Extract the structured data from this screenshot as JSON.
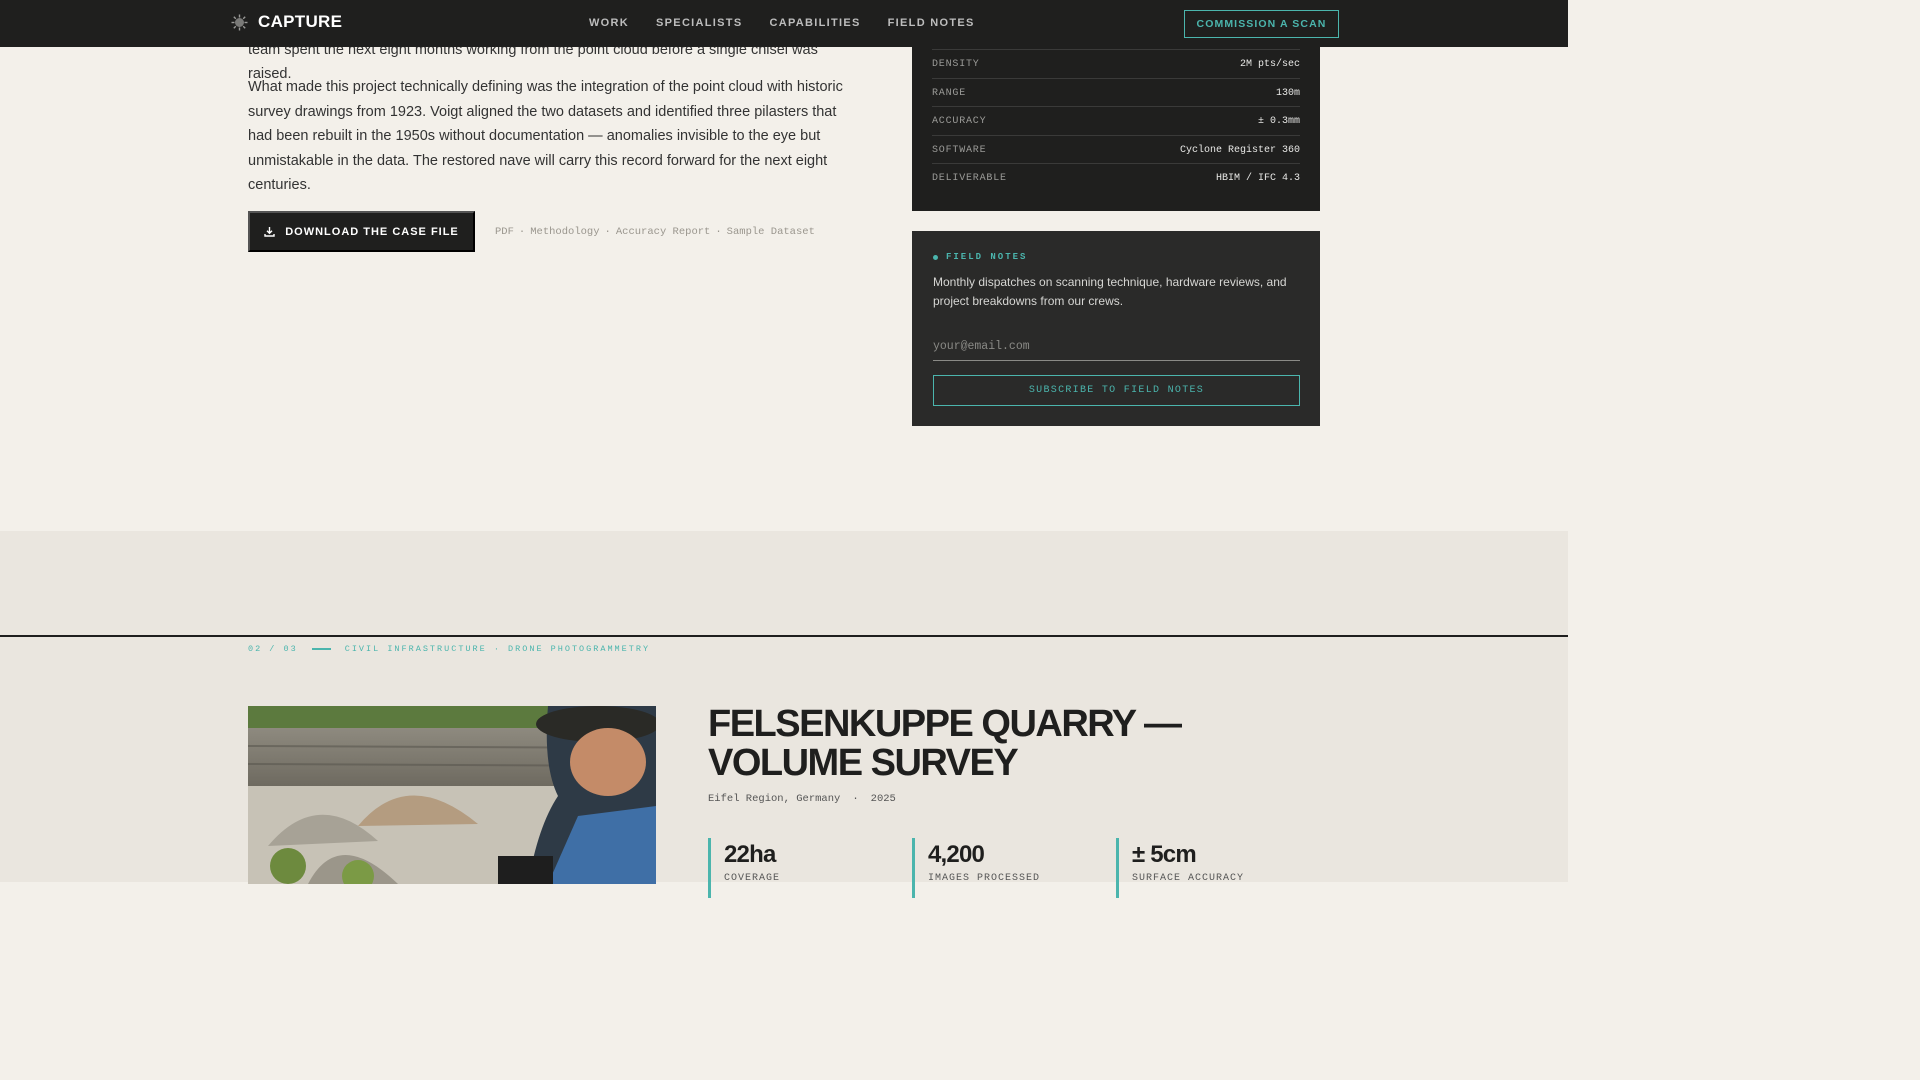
{
  "nav": {
    "brand": "CAPTURE",
    "links": [
      "WORK",
      "SPECIALISTS",
      "CAPABILITIES",
      "FIELD NOTES"
    ],
    "cta": "COMMISSION A SCAN"
  },
  "article": {
    "cut_line": "team spent the next eight months working from the point cloud before a single chisel was raised.",
    "paragraph": "What made this project technically defining was the integration of the point cloud with historic survey drawings from 1923. Voigt aligned the two datasets and identified three pilasters that had been rebuilt in the 1950s without documentation — anomalies invisible to the eye but unmistakable in the data. The restored nave will carry this record forward for the next eight centuries.",
    "download_label": "DOWNLOAD THE CASE FILE",
    "file_meta": [
      "PDF",
      "Methodology",
      "Accuracy Report",
      "Sample Dataset"
    ]
  },
  "specs": {
    "rows": [
      {
        "label": "DENSITY",
        "value": "2M pts/sec"
      },
      {
        "label": "RANGE",
        "value": "130m"
      },
      {
        "label": "ACCURACY",
        "value": "± 0.3mm"
      },
      {
        "label": "SOFTWARE",
        "value": "Cyclone Register 360"
      },
      {
        "label": "DELIVERABLE",
        "value": "HBIM / IFC 4.3"
      }
    ]
  },
  "field_notes": {
    "eyebrow": "FIELD NOTES",
    "description": "Monthly dispatches on scanning technique, hardware reviews, and project breakdowns from our crews.",
    "email_placeholder": "your@email.com",
    "subscribe_label": "SUBSCRIBE TO FIELD NOTES"
  },
  "case2": {
    "index": "02 / 03",
    "category": "CIVIL INFRASTRUCTURE · DRONE PHOTOGRAMMETRY",
    "title": "FELSENKUPPE QUARRY — VOLUME SURVEY",
    "location": "Eifel Region, Germany",
    "year": "2025",
    "stats": [
      {
        "value": "22ha",
        "label": "COVERAGE"
      },
      {
        "value": "4,200",
        "label": "IMAGES PROCESSED"
      },
      {
        "value": "± 5cm",
        "label": "SURFACE ACCURACY"
      }
    ]
  },
  "colors": {
    "accent": "#4bb5ad",
    "dark": "#1f1f1e",
    "page_bg": "#f3f0ea",
    "section_bg": "#eae6df"
  }
}
